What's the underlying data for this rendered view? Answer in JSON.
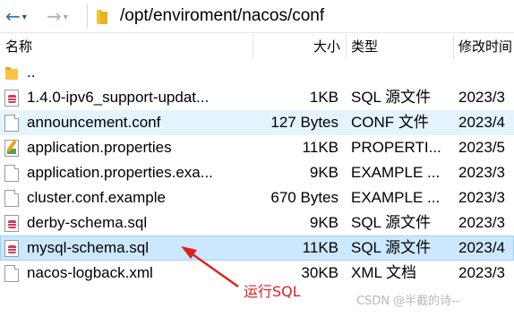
{
  "toolbar": {
    "back_icon": "back-arrow-icon",
    "forward_icon": "forward-arrow-icon",
    "path": "/opt/enviroment/nacos/conf"
  },
  "columns": {
    "name": "名称",
    "size": "大小",
    "type": "类型",
    "modified": "修改时间"
  },
  "files": [
    {
      "icon": "folder-icon",
      "name": "..",
      "size": "",
      "type": "",
      "modified": ""
    },
    {
      "icon": "sql-file-icon",
      "name": "1.4.0-ipv6_support-updat...",
      "size": "1KB",
      "type": "SQL 源文件",
      "modified": "2023/3"
    },
    {
      "icon": "document-icon",
      "name": "announcement.conf",
      "size": "127 Bytes",
      "type": "CONF 文件",
      "modified": "2023/4"
    },
    {
      "icon": "properties-file-icon",
      "name": "application.properties",
      "size": "11KB",
      "type": "PROPERTI...",
      "modified": "2023/5"
    },
    {
      "icon": "document-icon",
      "name": "application.properties.exa...",
      "size": "9KB",
      "type": "EXAMPLE ...",
      "modified": "2023/3"
    },
    {
      "icon": "document-icon",
      "name": "cluster.conf.example",
      "size": "670 Bytes",
      "type": "EXAMPLE ...",
      "modified": "2023/3"
    },
    {
      "icon": "sql-file-icon",
      "name": "derby-schema.sql",
      "size": "9KB",
      "type": "SQL 源文件",
      "modified": "2023/3"
    },
    {
      "icon": "sql-file-icon",
      "name": "mysql-schema.sql",
      "size": "11KB",
      "type": "SQL 源文件",
      "modified": "2023/4"
    },
    {
      "icon": "document-icon",
      "name": "nacos-logback.xml",
      "size": "30KB",
      "type": "XML 文档",
      "modified": "2023/3"
    }
  ],
  "annotation": {
    "label": "运行SQL",
    "color": "#e02020"
  },
  "watermark": "CSDN @半截的诗--"
}
